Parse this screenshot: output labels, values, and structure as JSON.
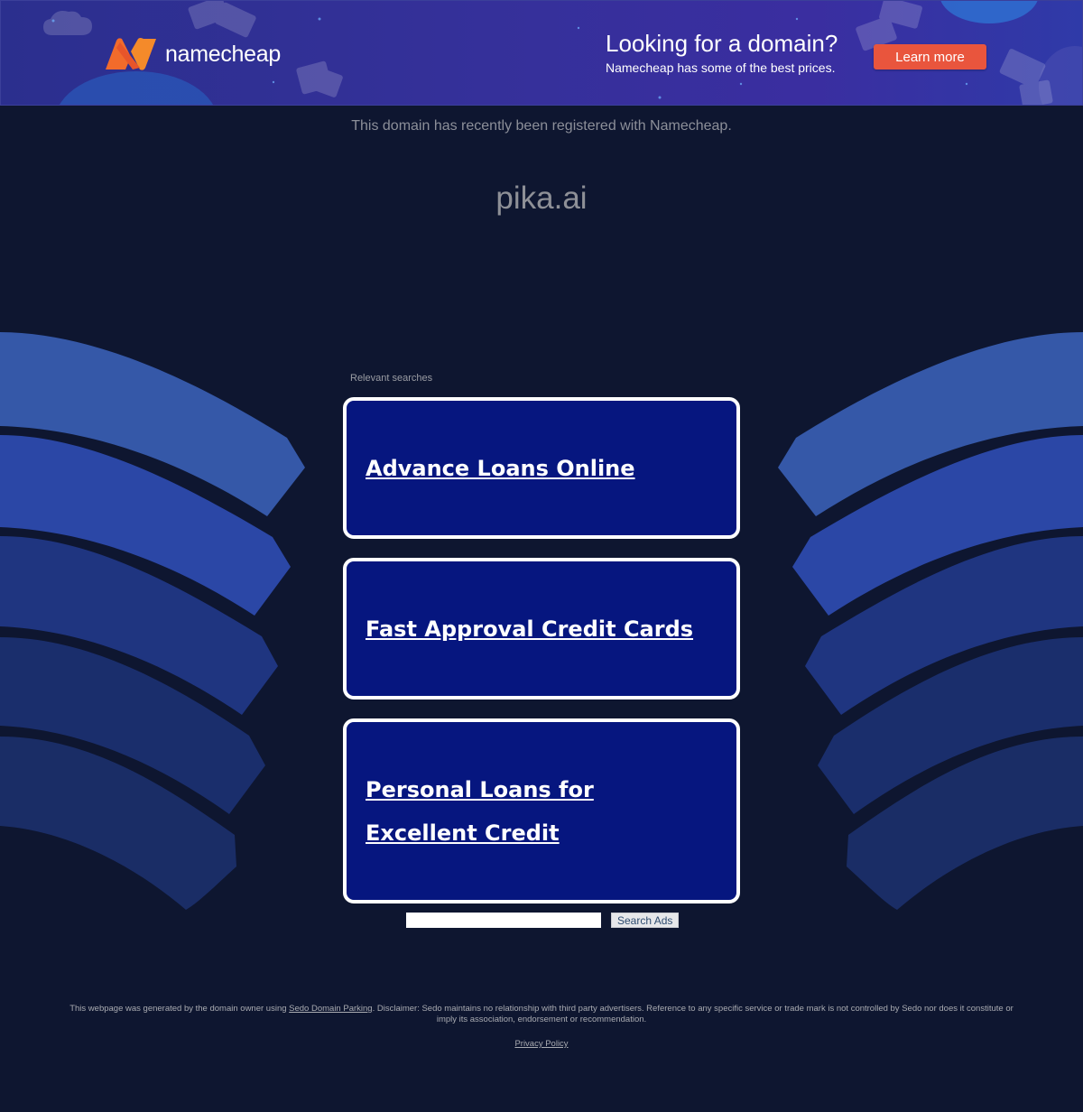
{
  "banner": {
    "brand": "namecheap",
    "promo_title": "Looking for a domain?",
    "promo_subtitle": "Namecheap has some of the best prices.",
    "cta_label": "Learn more",
    "colors": {
      "background": "#35309a",
      "cta": "#e9553d",
      "logo_orange": "#f26b2b"
    }
  },
  "registered_text": "This domain has recently been registered with Namecheap.",
  "domain": "pika.ai",
  "relevant_label": "Relevant searches",
  "searches": [
    "Advance Loans Online",
    "Fast Approval Credit Cards",
    "Personal Loans for Excellent Credit"
  ],
  "search": {
    "button_label": "Search Ads",
    "value": ""
  },
  "footer": {
    "text_before": "This webpage was generated by the domain owner using ",
    "link_text": "Sedo Domain Parking",
    "text_after": ". Disclaimer: Sedo maintains no relationship with third party advertisers. Reference to any specific service or trade mark is not controlled by Sedo nor does it constitute or imply its association, endorsement or recommendation.",
    "privacy_label": "Privacy Policy"
  },
  "colors": {
    "page_background": "#0e1630",
    "result_box": "#06167f"
  }
}
